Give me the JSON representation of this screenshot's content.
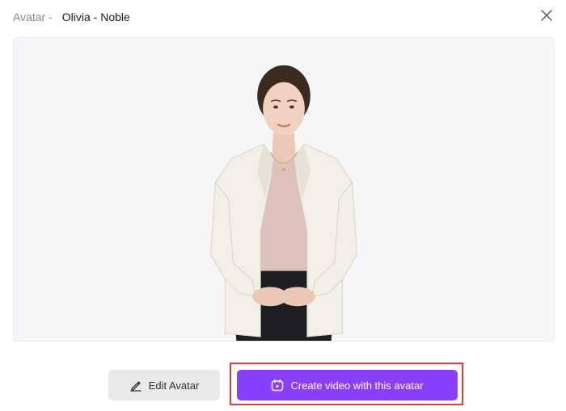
{
  "header": {
    "prefix": "Avatar -",
    "avatar_name": "Olivia - Noble"
  },
  "icons": {
    "close": "close-icon",
    "edit": "pencil-icon",
    "create": "calendar-video-icon"
  },
  "actions": {
    "edit_label": "Edit Avatar",
    "create_label": "Create video with this avatar"
  },
  "colors": {
    "primary": "#8a3ffc",
    "highlight": "#e03a3a",
    "secondary_button": "#e9e9ec"
  }
}
